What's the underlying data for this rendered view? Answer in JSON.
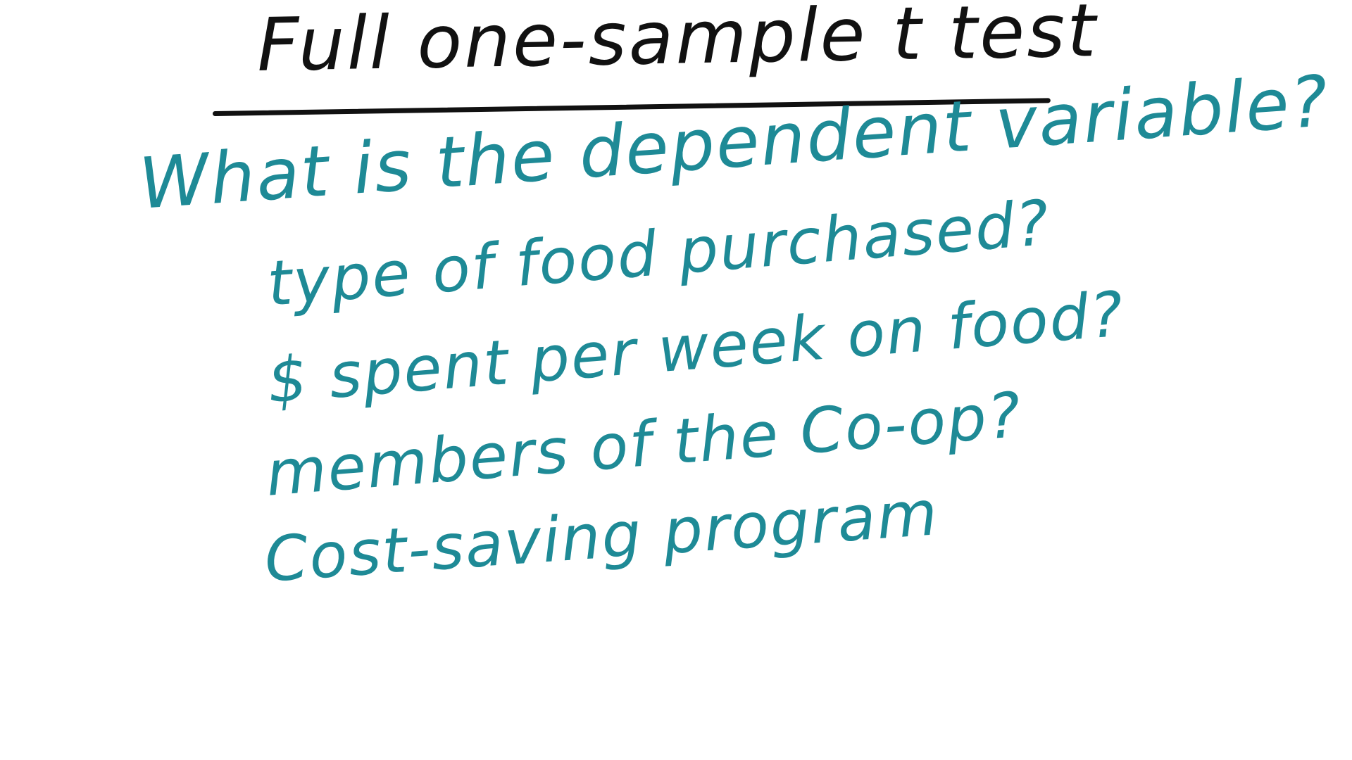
{
  "board": {
    "title": "Full one-sample t test",
    "question": "What is the dependent variable?",
    "options": [
      "type of food purchased?",
      "$ spent per week on food?",
      "members of the Co-op?",
      "Cost-saving program"
    ],
    "colors": {
      "background": "#ffffff",
      "title_ink": "#111111",
      "body_ink": "#1e8a96"
    }
  }
}
